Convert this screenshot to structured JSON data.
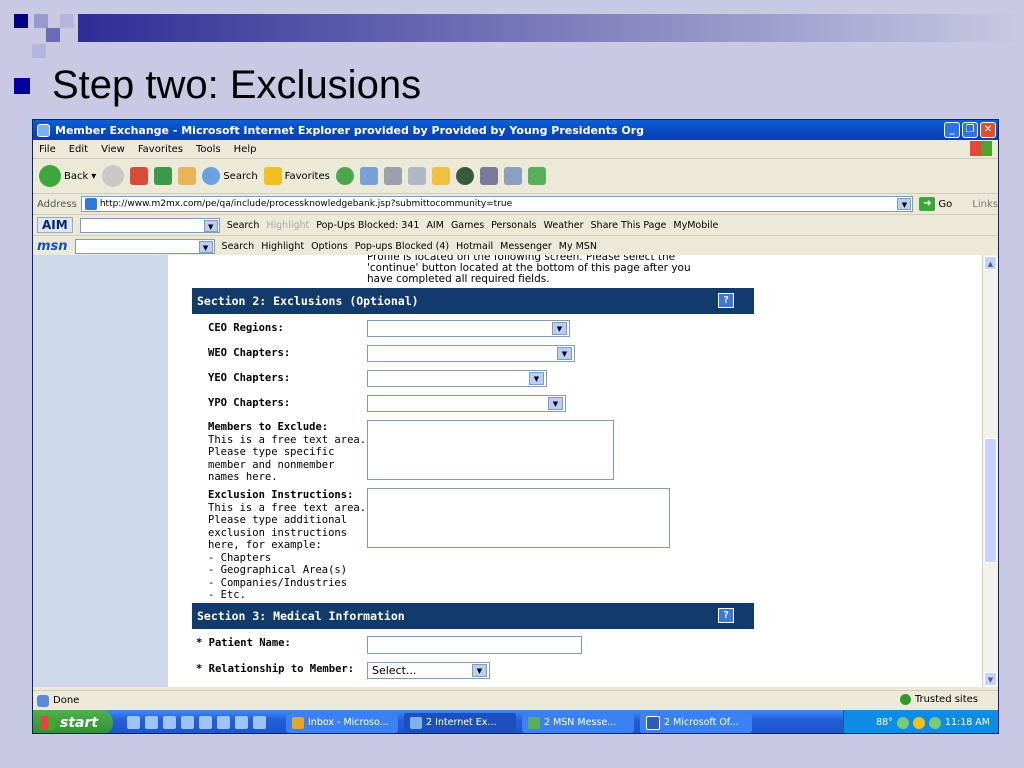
{
  "slide": {
    "title": "Step two: Exclusions"
  },
  "window": {
    "title": "Member Exchange - Microsoft Internet Explorer provided by Provided by Young Presidents Org",
    "buttons": {
      "minimize": "_",
      "maximize": "❐",
      "close": "✕"
    }
  },
  "menu": [
    "File",
    "Edit",
    "View",
    "Favorites",
    "Tools",
    "Help"
  ],
  "toolbar": {
    "back": "Back",
    "search": "Search",
    "favorites": "Favorites"
  },
  "address": {
    "label": "Address",
    "url": "http://www.m2mx.com/pe/qa/include/processknowledgebank.jsp?submittocommunity=true",
    "go": "Go",
    "links": "Links"
  },
  "aimbar": {
    "logo": "AIM",
    "search": "Search",
    "highlight": "Highlight",
    "popups": "Pop-Ups Blocked: 341",
    "aim": "AIM",
    "games": "Games",
    "personals": "Personals",
    "weather": "Weather",
    "share": "Share This Page",
    "mymobile": "MyMobile"
  },
  "msnbar": {
    "logo": "msn",
    "search": "Search",
    "highlight": "Highlight",
    "options": "Options",
    "popups": "Pop-ups Blocked (4)",
    "hotmail": "Hotmail",
    "messenger": "Messenger",
    "mymsn": "My MSN"
  },
  "page": {
    "intro_lines": [
      "Profile is located on the following screen. Please select the",
      "'continue' button located at the bottom of this page after you",
      "have completed all required fields."
    ],
    "section2": {
      "title": "Section 2: Exclusions (Optional)",
      "help": "?",
      "ceo_label": "CEO Regions:",
      "weo_label": "WEO Chapters:",
      "yeo_label": "YEO Chapters:",
      "ypo_label": "YPO Chapters:",
      "members_title": "Members to Exclude:",
      "members_desc": [
        "This is a free text area.",
        "Please type specific",
        "member and nonmember",
        "names here."
      ],
      "exclusion_title": "Exclusion Instructions:",
      "exclusion_desc": [
        "This is a free text area.",
        "Please type additional",
        "exclusion instructions",
        "here, for example:",
        "- Chapters",
        "- Geographical Area(s)",
        "- Companies/Industries",
        "- Etc."
      ]
    },
    "section3": {
      "title": "Section 3: Medical Information",
      "help": "?",
      "patient_label": "* Patient Name:",
      "relationship_label": "* Relationship to Member:",
      "relationship_value": "Select..."
    }
  },
  "status": {
    "text": "Done",
    "zone": "Trusted sites"
  },
  "taskbar": {
    "start": "start",
    "tasks": [
      "Inbox - Microso...",
      "2 Internet Ex...",
      "2 MSN Messe...",
      "2 Microsoft Of..."
    ],
    "temp": "88°",
    "time": "11:18 AM"
  }
}
